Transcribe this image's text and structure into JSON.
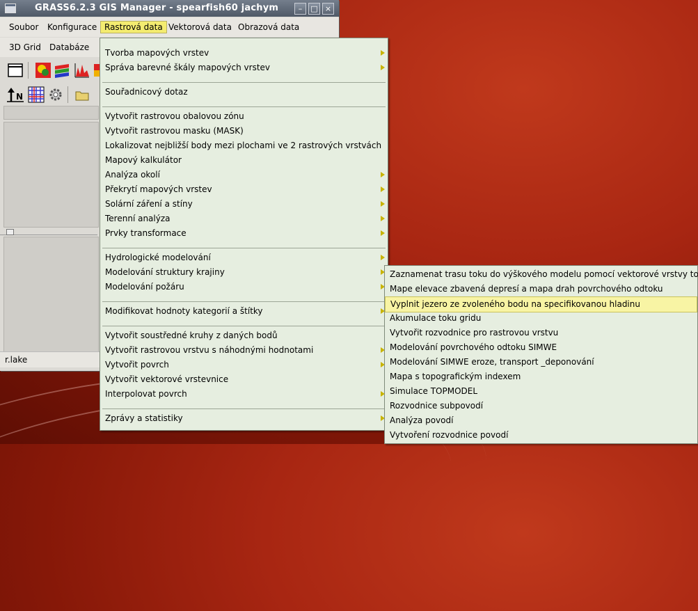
{
  "window": {
    "title": "GRASS6.2.3 GIS Manager - spearfish60 jachym",
    "minimize": "–",
    "maximize": "□",
    "close": "×"
  },
  "menubar1": [
    "Soubor",
    "Konfigurace",
    "Rastrová data",
    "Vektorová data",
    "Obrazová data"
  ],
  "menubar2": [
    "3D Grid",
    "Databáze"
  ],
  "status_text": "r.lake",
  "raster_menu": [
    {
      "label": "Tvorba mapových vrstev",
      "sub": true
    },
    {
      "label": "Správa barevné škály mapových vrstev",
      "sub": true
    },
    {
      "label": "Souřadnicový dotaz",
      "sub": false
    },
    {
      "label": "Vytvořit rastrovou obalovou zónu",
      "sub": false
    },
    {
      "label": "Vytvořit rastrovou masku (MASK)",
      "sub": false
    },
    {
      "label": "Lokalizovat nejbližší body mezi plochami ve 2 rastrových vrstvách",
      "sub": false
    },
    {
      "label": "Mapový kalkulátor",
      "sub": false
    },
    {
      "label": "Analýza okolí",
      "sub": true
    },
    {
      "label": "Překrytí mapových vrstev",
      "sub": true
    },
    {
      "label": "Solární záření a stíny",
      "sub": true
    },
    {
      "label": "Terenní analýza",
      "sub": true
    },
    {
      "label": "Prvky transformace",
      "sub": true
    },
    {
      "label": "Hydrologické modelování",
      "sub": true
    },
    {
      "label": "Modelování struktury krajiny",
      "sub": true
    },
    {
      "label": "Modelování požáru",
      "sub": true
    },
    {
      "label": "Modifikovat hodnoty kategorií a štítky",
      "sub": true
    },
    {
      "label": "Vytvořit soustředné kruhy z daných bodů",
      "sub": false
    },
    {
      "label": "Vytvořit rastrovou vrstvu s náhodnými hodnotami",
      "sub": true
    },
    {
      "label": "Vytvořit povrch",
      "sub": true
    },
    {
      "label": "Vytvořit vektorové vrstevnice",
      "sub": false
    },
    {
      "label": "Interpolovat povrch",
      "sub": true
    },
    {
      "label": "Zprávy a statistiky",
      "sub": true
    }
  ],
  "hydro_menu": [
    "Zaznamenat trasu toku do výškového modelu pomocí vektorové vrstvy toku",
    "Mape elevace zbavená depresí a mapa drah povrchového odtoku",
    "Vyplnit jezero ze zvoleného bodu na specifikovanou hladinu",
    "Akumulace toku gridu",
    "Vytvořit rozvodnice pro rastrovou vrstvu",
    "Modelování povrchového odtoku SIMWE",
    "Modelování SIMWE eroze, transport _deponování",
    "Mapa s topografickým indexem",
    "Simulace TOPMODEL",
    "Rozvodnice subpovodí",
    "Analýza povodí",
    "Vytvoření rozvodnice povodí"
  ],
  "hydro_highlight_index": 2,
  "colors": {
    "menu_bg": "#e6eee0",
    "highlight": "#f8f4a4",
    "arrow": "#c8b400",
    "desktop": "#a82612"
  }
}
